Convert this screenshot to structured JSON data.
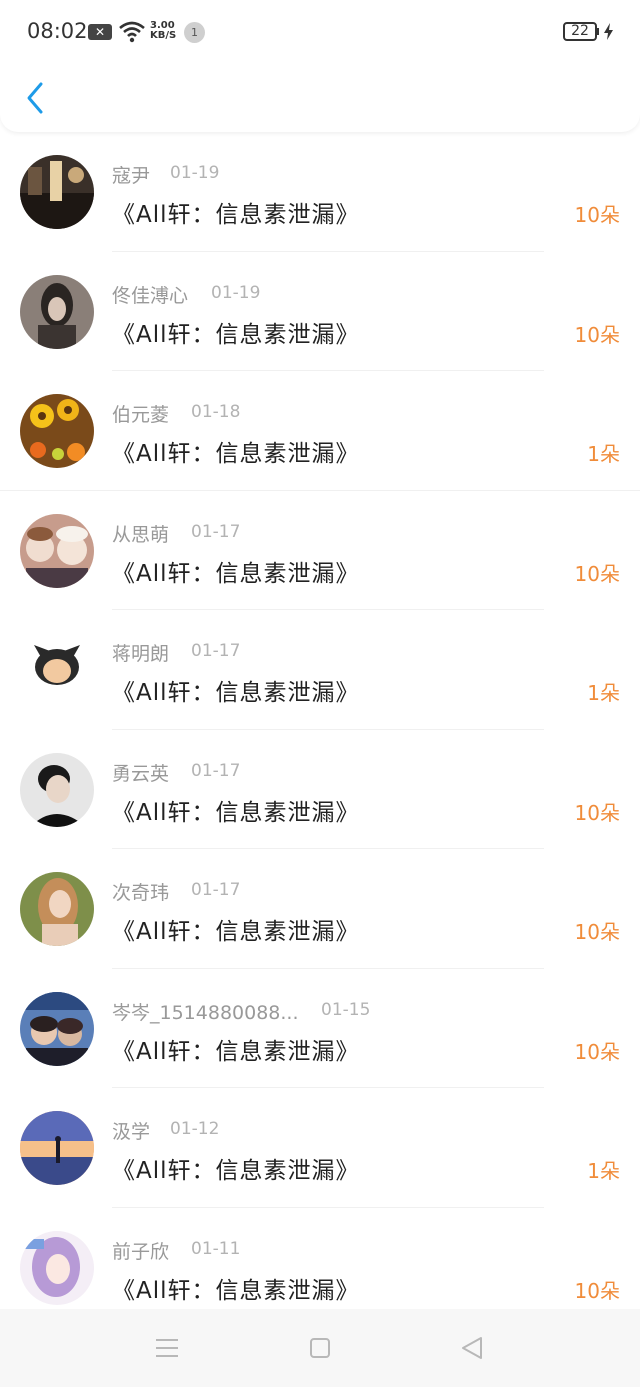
{
  "status_bar": {
    "time": "08:02",
    "net_speed_value": "3.00",
    "net_speed_unit": "KB/S",
    "notification_count": "1",
    "battery_level": "22"
  },
  "colors": {
    "accent": "#1e9be8",
    "amount": "#f08c3a"
  },
  "items": [
    {
      "name": "寇尹",
      "date": "01-19",
      "title": "《All轩：信息素泄漏》",
      "amount": "10朵"
    },
    {
      "name": "佟佳溥心",
      "date": "01-19",
      "title": "《All轩：信息素泄漏》",
      "amount": "10朵"
    },
    {
      "name": "伯元菱",
      "date": "01-18",
      "title": "《All轩：信息素泄漏》",
      "amount": "1朵"
    },
    {
      "name": "从思萌",
      "date": "01-17",
      "title": "《All轩：信息素泄漏》",
      "amount": "10朵"
    },
    {
      "name": "蒋明朗",
      "date": "01-17",
      "title": "《All轩：信息素泄漏》",
      "amount": "1朵"
    },
    {
      "name": "勇云英",
      "date": "01-17",
      "title": "《All轩：信息素泄漏》",
      "amount": "10朵"
    },
    {
      "name": "次奇玮",
      "date": "01-17",
      "title": "《All轩：信息素泄漏》",
      "amount": "10朵"
    },
    {
      "name": "岑岑_1514880088...",
      "date": "01-15",
      "title": "《All轩：信息素泄漏》",
      "amount": "10朵"
    },
    {
      "name": "汲学",
      "date": "01-12",
      "title": "《All轩：信息素泄漏》",
      "amount": "1朵"
    },
    {
      "name": "前子欣",
      "date": "01-11",
      "title": "《All轩：信息素泄漏》",
      "amount": "10朵"
    }
  ]
}
